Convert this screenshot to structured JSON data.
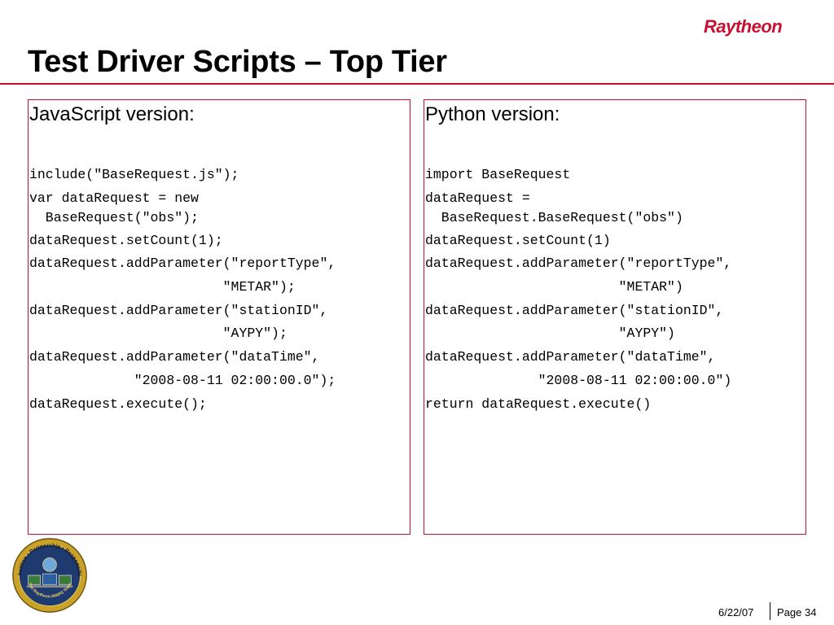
{
  "header": {
    "title": "Test Driver Scripts – Top Tier",
    "brand": "Raytheon",
    "accent_color": "#c8102e"
  },
  "panels": {
    "javascript": {
      "heading": "JavaScript version:",
      "lines": [
        "include(\"BaseRequest.js\");",
        "var dataRequest = new\n  BaseRequest(\"obs\");",
        "dataRequest.setCount(1);",
        "dataRequest.addParameter(\"reportType\",",
        "                        \"METAR\");",
        "dataRequest.addParameter(\"stationID\",",
        "                        \"AYPY\");",
        "dataRequest.addParameter(\"dataTime\",",
        "             \"2008-08-11 02:00:00.0\");",
        "dataRequest.execute();"
      ]
    },
    "python": {
      "heading": "Python version:",
      "lines": [
        "import BaseRequest",
        "dataRequest =\n  BaseRequest.BaseRequest(\"obs\")",
        "dataRequest.setCount(1)",
        "dataRequest.addParameter(\"reportType\",",
        "                        \"METAR\")",
        "dataRequest.addParameter(\"stationID\",",
        "                        \"AYPY\")",
        "dataRequest.addParameter(\"dataTime\",",
        "              \"2008-08-11 02:00:00.0\")",
        "return dataRequest.execute()"
      ]
    }
  },
  "seal": {
    "ring_text": "Innovation • Partnership • Responsibility",
    "bottom_text": "The Raytheon AWIPS Team"
  },
  "footer": {
    "date": "6/22/07",
    "page": "Page 34"
  }
}
